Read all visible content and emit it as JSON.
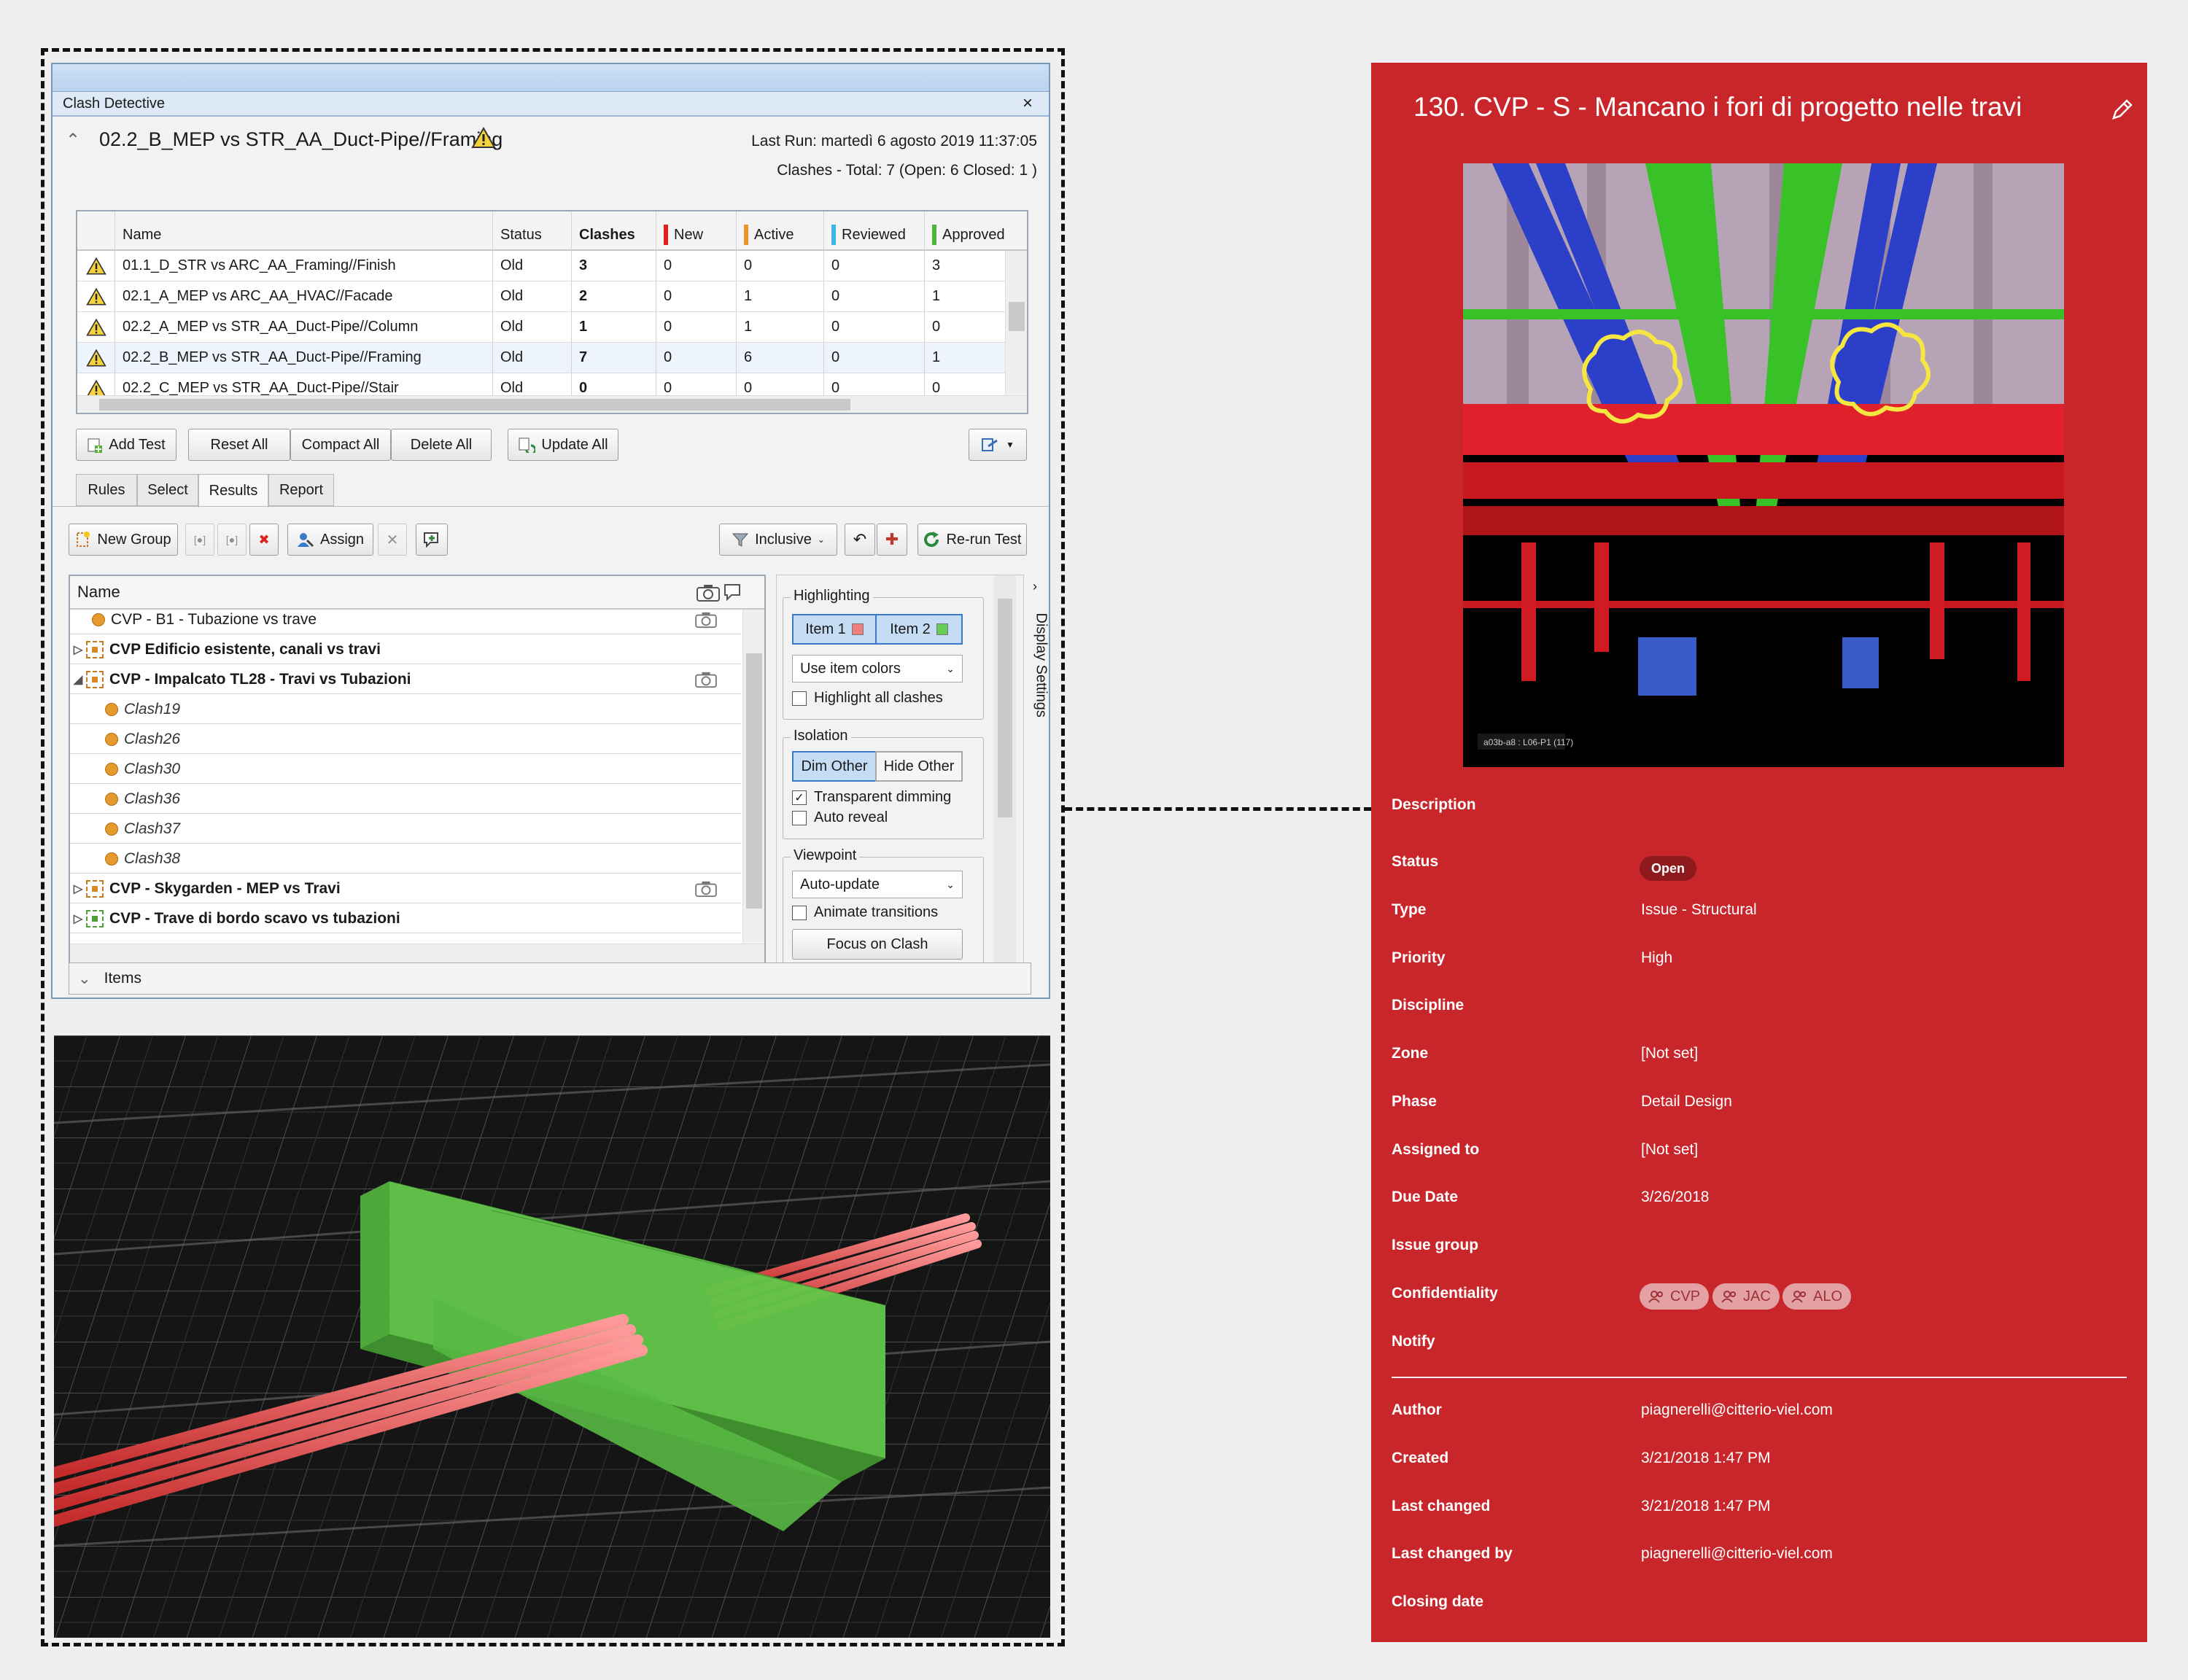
{
  "clash_window": {
    "title": "Clash Detective",
    "close_glyph": "×",
    "test_name": "02.2_B_MEP vs STR_AA_Duct-Pipe//Framing",
    "last_run": "Last Run:  martedì 6 agosto 2019 11:37:05",
    "clash_summary": "Clashes -  Total:  7  (Open:  6  Closed:  1 )",
    "columns": {
      "name": "Name",
      "status": "Status",
      "clashes": "Clashes",
      "new": "New",
      "active": "Active",
      "reviewed": "Reviewed",
      "approved": "Approved"
    },
    "tests": [
      {
        "name": "01.1_D_STR vs ARC_AA_Framing//Finish",
        "status": "Old",
        "clashes": "3",
        "new": "0",
        "active": "0",
        "reviewed": "0",
        "approved": "3"
      },
      {
        "name": "02.1_A_MEP vs ARC_AA_HVAC//Facade",
        "status": "Old",
        "clashes": "2",
        "new": "0",
        "active": "1",
        "reviewed": "0",
        "approved": "1"
      },
      {
        "name": "02.2_A_MEP vs STR_AA_Duct-Pipe//Column",
        "status": "Old",
        "clashes": "1",
        "new": "0",
        "active": "1",
        "reviewed": "0",
        "approved": "0"
      },
      {
        "name": "02.2_B_MEP vs STR_AA_Duct-Pipe//Framing",
        "status": "Old",
        "clashes": "7",
        "new": "0",
        "active": "6",
        "reviewed": "0",
        "approved": "1"
      },
      {
        "name": "02.2_C_MEP vs STR_AA_Duct-Pipe//Stair",
        "status": "Old",
        "clashes": "0",
        "new": "0",
        "active": "0",
        "reviewed": "0",
        "approved": "0"
      }
    ],
    "buttons": {
      "add_test": "Add Test",
      "reset_all": "Reset All",
      "compact_all": "Compact All",
      "delete_all": "Delete All",
      "update_all": "Update All"
    },
    "tabs": [
      "Rules",
      "Select",
      "Results",
      "Report"
    ],
    "results_toolbar": {
      "new_group": "New Group",
      "assign": "Assign",
      "inclusive": "Inclusive",
      "rerun": "Re-run Test"
    },
    "tree_header": "Name",
    "tree_rows": [
      {
        "label": "CVP - B1 - Tubazione vs trave",
        "kind": "leaf"
      },
      {
        "label": "CVP Edificio esistente, canali vs travi",
        "kind": "group",
        "expander": "▷"
      },
      {
        "label": "CVP - Impalcato TL28 - Travi vs Tubazioni",
        "kind": "group",
        "expander": "◢"
      },
      {
        "label": "Clash19",
        "kind": "child"
      },
      {
        "label": "Clash26",
        "kind": "child"
      },
      {
        "label": "Clash30",
        "kind": "child"
      },
      {
        "label": "Clash36",
        "kind": "child"
      },
      {
        "label": "Clash37",
        "kind": "child"
      },
      {
        "label": "Clash38",
        "kind": "child"
      },
      {
        "label": "CVP - Skygarden - MEP vs Travi",
        "kind": "group",
        "expander": "▷"
      },
      {
        "label": "CVP - Trave di bordo scavo vs tubazioni",
        "kind": "group",
        "expander": "▷"
      }
    ],
    "settings": {
      "highlighting": "Highlighting",
      "item1": "Item 1",
      "item2": "Item 2",
      "item1_color": "#f08080",
      "item2_color": "#66cc55",
      "use_item_colors": "Use item colors",
      "highlight_all": "Highlight all clashes",
      "isolation": "Isolation",
      "dim_other": "Dim Other",
      "hide_other": "Hide Other",
      "transparent_dimming": "Transparent dimming",
      "auto_reveal": "Auto reveal",
      "viewpoint": "Viewpoint",
      "auto_update": "Auto-update",
      "animate_transitions": "Animate transitions",
      "focus_on_clash": "Focus on Clash",
      "check_mark": "✓",
      "display_settings": "Display Settings"
    },
    "items_label": "Items"
  },
  "issue": {
    "title": "130. CVP - S - Mancano i fori di progetto nelle travi",
    "render_caption": "a03b-a8 : L06-P1 (117)",
    "fields": [
      {
        "label": "Description",
        "value": ""
      },
      {
        "label": "Status",
        "value": ""
      },
      {
        "label": "Type",
        "value": "Issue - Structural"
      },
      {
        "label": "Priority",
        "value": "High"
      },
      {
        "label": "Discipline",
        "value": ""
      },
      {
        "label": "Zone",
        "value": "[Not set]"
      },
      {
        "label": "Phase",
        "value": "Detail Design"
      },
      {
        "label": "Assigned to",
        "value": "[Not set]"
      },
      {
        "label": "Due Date",
        "value": "3/26/2018"
      },
      {
        "label": "Issue group",
        "value": ""
      },
      {
        "label": "Confidentiality",
        "value": ""
      },
      {
        "label": "Notify",
        "value": ""
      }
    ],
    "status_value": "Open",
    "confidentiality": [
      "CVP",
      "JAC",
      "ALO"
    ],
    "meta": [
      {
        "label": "Author",
        "value": "piagnerelli@citterio-viel.com"
      },
      {
        "label": "Created",
        "value": "3/21/2018 1:47 PM"
      },
      {
        "label": "Last changed",
        "value": "3/21/2018 1:47 PM"
      },
      {
        "label": "Last changed by",
        "value": "piagnerelli@citterio-viel.com"
      },
      {
        "label": "Closing date",
        "value": ""
      }
    ],
    "panel_color": "#c8262a"
  }
}
